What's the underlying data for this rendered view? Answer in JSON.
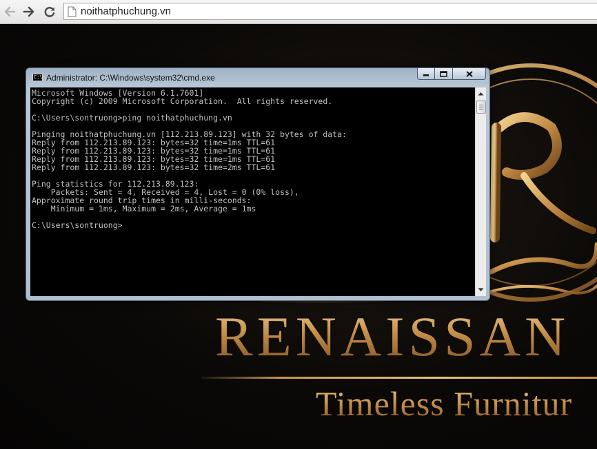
{
  "browser": {
    "url": "noithatphuchung.vn",
    "icons": [
      "back-arrow-icon",
      "forward-arrow-icon",
      "reload-icon",
      "page-icon"
    ]
  },
  "website": {
    "brand_name": "RENAISSAN",
    "tagline": "Timeless Furnitur",
    "colors": {
      "gold": "#c8964e",
      "background": "#0a0806"
    }
  },
  "cmd": {
    "title": "Administrator: C:\\Windows\\system32\\cmd.exe",
    "buttons": {
      "minimize": "minimize-icon",
      "maximize": "maximize-icon",
      "close": "close-icon"
    },
    "lines": [
      "Microsoft Windows [Version 6.1.7601]",
      "Copyright (c) 2009 Microsoft Corporation.  All rights reserved.",
      "",
      "C:\\Users\\sontruong>ping noithatphuchung.vn",
      "",
      "Pinging noithatphuchung.vn [112.213.89.123] with 32 bytes of data:",
      "Reply from 112.213.89.123: bytes=32 time=1ms TTL=61",
      "Reply from 112.213.89.123: bytes=32 time=1ms TTL=61",
      "Reply from 112.213.89.123: bytes=32 time=1ms TTL=61",
      "Reply from 112.213.89.123: bytes=32 time=2ms TTL=61",
      "",
      "Ping statistics for 112.213.89.123:",
      "    Packets: Sent = 4, Received = 4, Lost = 0 (0% loss),",
      "Approximate round trip times in milli-seconds:",
      "    Minimum = 1ms, Maximum = 2ms, Average = 1ms",
      "",
      "C:\\Users\\sontruong>"
    ],
    "colors": {
      "console_bg": "#000000",
      "console_text": "#c0c0c0"
    }
  }
}
